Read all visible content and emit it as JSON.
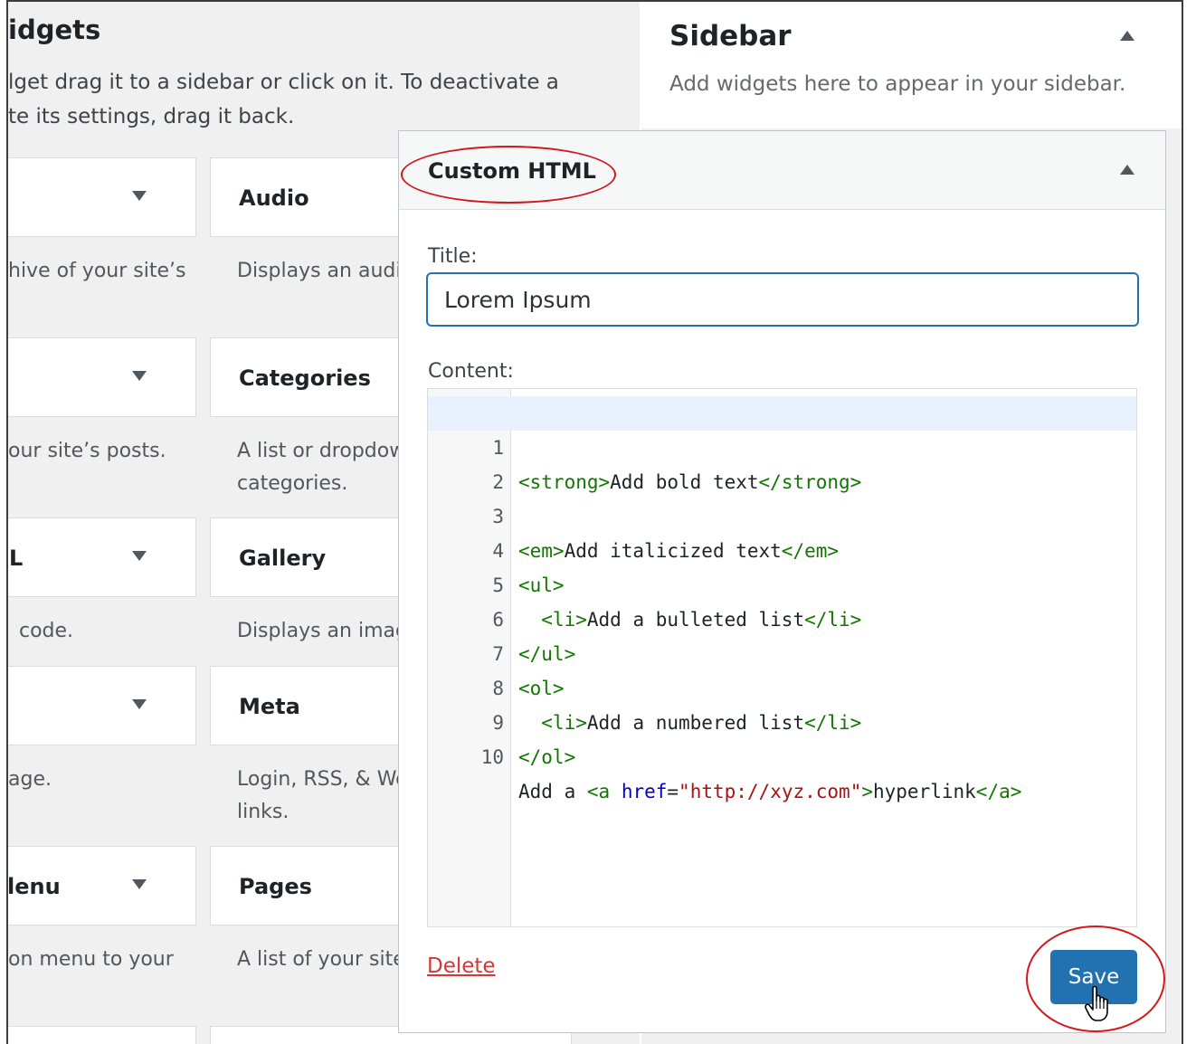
{
  "left_pane": {
    "page_title": "idgets",
    "description_line1": "lget drag it to a sidebar or click on it. To deactivate a",
    "description_line2": "te its settings, drag it back.",
    "widgets_col1": [
      {
        "title": "",
        "desc1": "hive of your site’s",
        "desc2": ""
      },
      {
        "title": "",
        "desc1": "our site’s posts.",
        "desc2": ""
      },
      {
        "title": "L",
        "desc1": "code.",
        "desc2": ""
      },
      {
        "title": "",
        "desc1": "age.",
        "desc2": ""
      },
      {
        "title": "lenu",
        "desc1": "on menu to your",
        "desc2": ""
      }
    ],
    "widgets_col2": [
      {
        "title": "Audio",
        "desc1": "Displays an audic",
        "desc2": ""
      },
      {
        "title": "Categories",
        "desc1": "A list or dropdow",
        "desc2": "categories."
      },
      {
        "title": "Gallery",
        "desc1": "Displays an imag",
        "desc2": ""
      },
      {
        "title": "Meta",
        "desc1": "Login, RSS, & Wo",
        "desc2": "links."
      },
      {
        "title": "Pages",
        "desc1": "A list of your site’",
        "desc2": ""
      }
    ]
  },
  "sidebar": {
    "title": "Sidebar",
    "subtitle": "Add widgets here to appear in your sidebar."
  },
  "custom_html_widget": {
    "title": "Custom HTML",
    "title_label": "Title:",
    "title_value": "Lorem Ipsum",
    "content_label": "Content:",
    "delete_label": "Delete",
    "save_label": "Save",
    "code_lines": [
      "1",
      "2",
      "3",
      "4",
      "5",
      "6",
      "7",
      "8",
      "9",
      "10"
    ]
  },
  "colors": {
    "accent": "#2271b1",
    "delete": "#d63638",
    "highlight_circle": "#d0191e",
    "tag": "#117700",
    "attr": "#0000cc",
    "string": "#aa1111"
  }
}
